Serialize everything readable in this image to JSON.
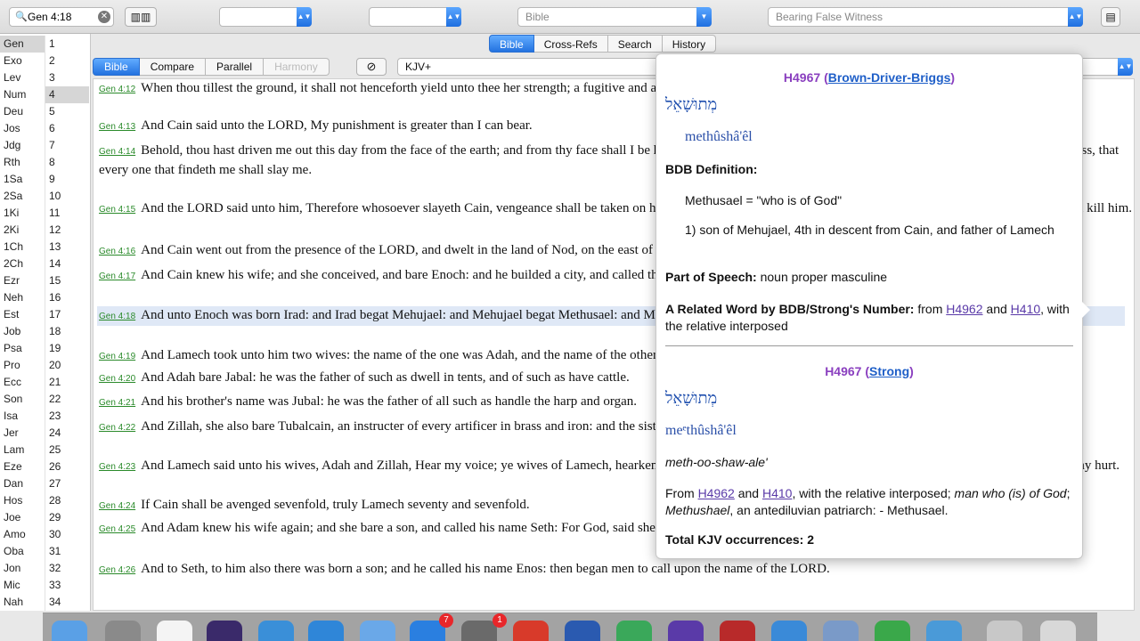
{
  "toolbar": {
    "search_value": "Gen 4:18",
    "select1": "",
    "select2": "",
    "select3": "Bible",
    "select4": "Bearing False Witness"
  },
  "tabs": [
    "Bible",
    "Cross-Refs",
    "Search",
    "History"
  ],
  "segments": [
    "Bible",
    "Compare",
    "Parallel",
    "Harmony"
  ],
  "module": "KJV+",
  "books": [
    "Gen",
    "Exo",
    "Lev",
    "Num",
    "Deu",
    "Jos",
    "Jdg",
    "Rth",
    "1Sa",
    "2Sa",
    "1Ki",
    "2Ki",
    "1Ch",
    "2Ch",
    "Ezr",
    "Neh",
    "Est",
    "Job",
    "Psa",
    "Pro",
    "Ecc",
    "Son",
    "Isa",
    "Jer",
    "Lam",
    "Eze",
    "Dan",
    "Hos",
    "Joe",
    "Amo",
    "Oba",
    "Jon",
    "Mic",
    "Nah"
  ],
  "chapters": [
    "1",
    "2",
    "3",
    "4",
    "5",
    "6",
    "7",
    "8",
    "9",
    "10",
    "11",
    "12",
    "13",
    "14",
    "15",
    "16",
    "17",
    "18",
    "19",
    "20",
    "21",
    "22",
    "23",
    "24",
    "25",
    "26",
    "27",
    "28",
    "29",
    "30",
    "31",
    "32",
    "33",
    "34"
  ],
  "verses": [
    {
      "ref": "Gen 4:12",
      "text": "When thou tillest the ground, it shall not henceforth yield unto thee her strength; a fugitive and a vagabond shalt thou be in the earth."
    },
    {
      "ref": "Gen 4:13",
      "text": "And Cain said unto the LORD, My punishment is greater than I can bear."
    },
    {
      "ref": "Gen 4:14",
      "text": "Behold, thou hast driven me out this day from the face of the earth; and from thy face shall I be hid; and I shall be a fugitive and a vagabond in the earth; and it shall come to pass, that every one that findeth me shall slay me."
    },
    {
      "ref": "Gen 4:15",
      "text": "And the LORD said unto him, Therefore whosoever slayeth Cain, vengeance shall be taken on him sevenfold. And the LORD set a mark upon Cain, lest any finding him should kill him."
    },
    {
      "ref": "Gen 4:16",
      "text": "And Cain went out from the presence of the LORD, and dwelt in the land of Nod, on the east of Eden."
    },
    {
      "ref": "Gen 4:17",
      "text": "And Cain knew his wife; and she conceived, and bare Enoch: and he builded a city, and called the name of the city, after the name of his son, Enoch."
    },
    {
      "ref": "Gen 4:18",
      "text": "And unto Enoch was born Irad: and Irad begat Mehujael: and Mehujael begat Methusael: and Methusael begat Lamech."
    },
    {
      "ref": "Gen 4:19",
      "text": "And Lamech took unto him two wives: the name of the one was Adah, and the name of the other Zillah."
    },
    {
      "ref": "Gen 4:20",
      "text": "And Adah bare Jabal: he was the father of such as dwell in tents, and of such as have cattle."
    },
    {
      "ref": "Gen 4:21",
      "text": "And his brother's name was Jubal: he was the father of all such as handle the harp and organ."
    },
    {
      "ref": "Gen 4:22",
      "text": "And Zillah, she also bare Tubalcain, an instructer of every artificer in brass and iron: and the sister of Tubalcain was Naamah."
    },
    {
      "ref": "Gen 4:23",
      "text": "And Lamech said unto his wives, Adah and Zillah, Hear my voice; ye wives of Lamech, hearken unto my speech: for I have slain a man to my wounding, and a young man to my hurt."
    },
    {
      "ref": "Gen 4:24",
      "text": "If Cain shall be avenged sevenfold, truly Lamech seventy and sevenfold."
    },
    {
      "ref": "Gen 4:25",
      "text": "And Adam knew his wife again; and she bare a son, and called his name Seth: For God, said she, hath appointed me another seed instead of Abel, whom Cain slew."
    },
    {
      "ref": "Gen 4:26",
      "text": "And to Seth, to him also there was born a son; and he called his name Enos: then began men to call upon the name of the LORD."
    }
  ],
  "popup": {
    "bdb": {
      "strong": "H4967",
      "source": "Brown-Driver-Briggs",
      "hebrew": "מְתוּשָׁאֵל",
      "translit": "methûshâ'êl",
      "def_label": "BDB Definition:",
      "def_line1": "Methusael = \"who is of God\"",
      "def_line2": "1) son of Mehujael, 4th in descent from Cain, and father of Lamech",
      "pos_label": "Part of Speech:",
      "pos_value": "noun proper masculine",
      "related_label": "A Related Word by BDB/Strong's Number:",
      "related_from": "from",
      "related_1": "H4962",
      "related_and": "and",
      "related_2": "H410",
      "related_tail": ", with the relative interposed"
    },
    "strong": {
      "strong": "H4967",
      "source": "Strong",
      "hebrew": "מְתוּשָׁאֵל",
      "translit": "meᵉthûshâ'êl",
      "pron": "meth-oo-shaw-ale'",
      "from": "From",
      "ref1": "H4962",
      "and": "and",
      "ref2": "H410",
      "tail1": ", with the relative interposed;",
      "tail_italic1": "man who (is) of God",
      "tail2": ";",
      "tail_italic2": "Methushael",
      "tail3": ", an antediluvian patriarch: - Methusael.",
      "total_label": "Total KJV occurrences: 2"
    }
  },
  "dock": {
    "badge1": "7",
    "badge2": "1"
  }
}
